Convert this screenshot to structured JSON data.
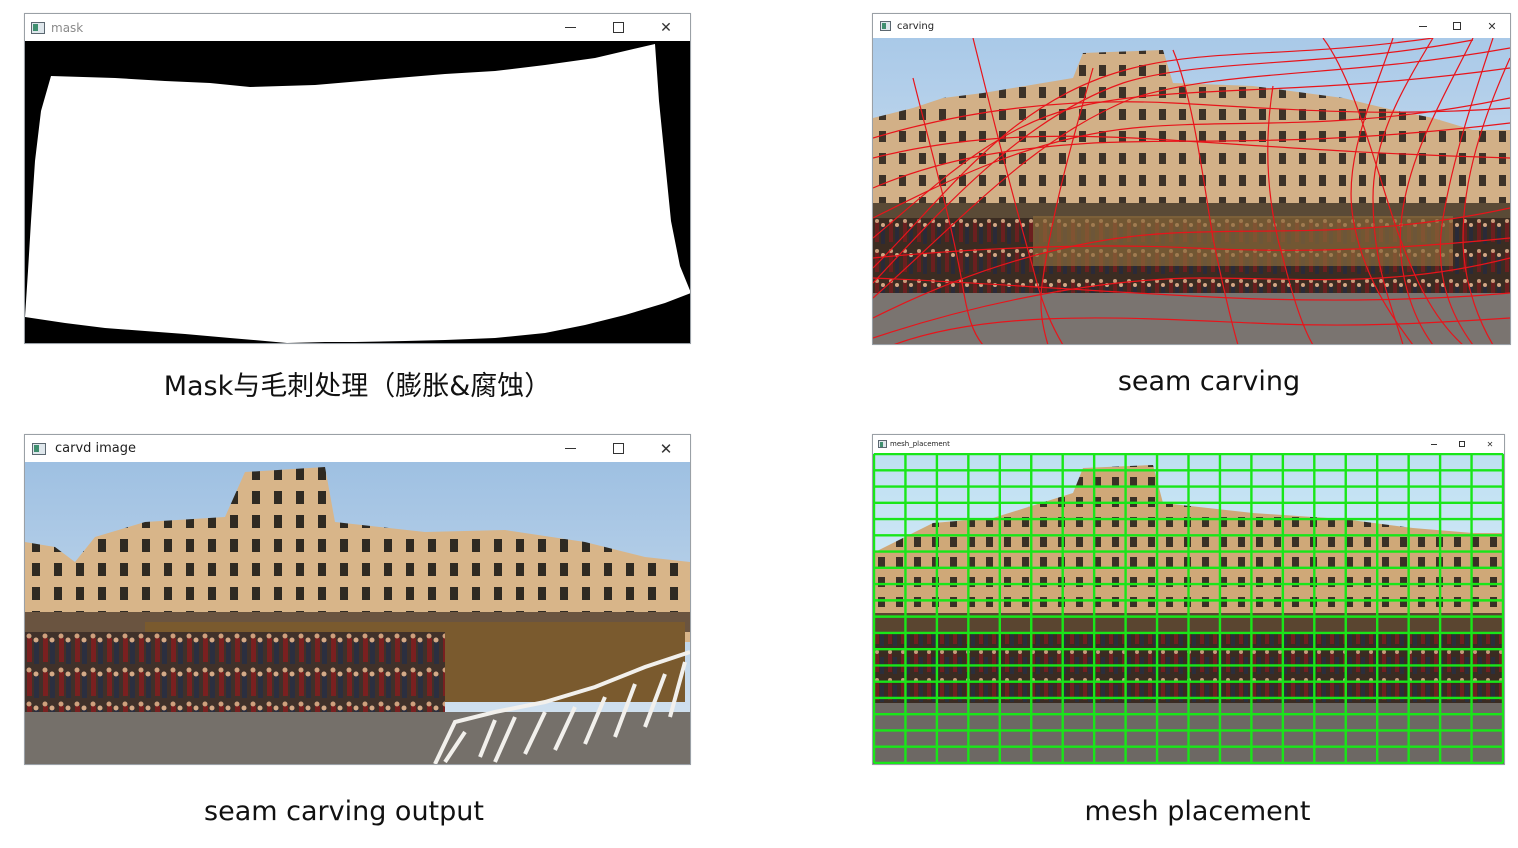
{
  "windows": {
    "mask": {
      "title": "mask"
    },
    "carving": {
      "title": "carving"
    },
    "carved": {
      "title": "carvd image"
    },
    "mesh": {
      "title": "mesh_placement"
    }
  },
  "captions": {
    "mask": "Mask与毛刺处理（膨胀&腐蚀）",
    "carving": "seam carving",
    "carved": "seam carving output",
    "mesh": "mesh placement"
  },
  "controls": {
    "minimize": "–",
    "close": "✕"
  },
  "colors": {
    "seam_lines": "#e8141b",
    "mesh_grid": "#19e619",
    "mask_fill": "#ffffff",
    "mask_background": "#000000",
    "sky": "#c9dcee",
    "building": "#c9a57a"
  },
  "icons": {
    "window_icon": "app-window-icon",
    "minimize": "minimize-icon",
    "maximize": "maximize-icon",
    "close": "close-icon"
  }
}
